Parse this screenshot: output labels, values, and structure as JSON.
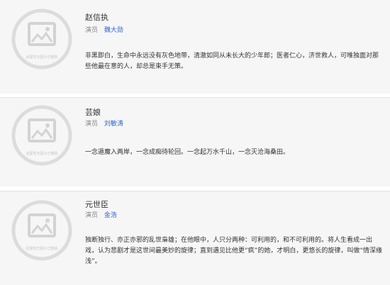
{
  "cast": [
    {
      "character": "赵信执",
      "role_label": "演员",
      "actor": "魏大勋",
      "description": "非黑即白，生命中永远没有灰色地带，清澈如同从未长大的少年郎；医者仁心，济世救人，可唯独面对那些他最在意的人，却总是束手无策。",
      "placeholder_caption": "此图暂无图片已删除"
    },
    {
      "character": "芸娘",
      "role_label": "演员",
      "actor": "刘敏涛",
      "description": "一念遁魔入两岸，一念成痴待轮回。一念起万水千山，一念灭沧海桑田。",
      "placeholder_caption": "此图暂无图片已删除"
    },
    {
      "character": "元世臣",
      "role_label": "演员",
      "actor": "金浩",
      "description": "独断独行、亦正亦邪的乱世枭雄；在他眼中，人只分两种：可利用的，和不可利用的。将人生看成一出戏，认为悲剧才是这世间最美妙的旋律；直到遇见比他更“疯”的她，才明白，更悠长的旋律，叫做“情深缘浅”。",
      "placeholder_caption": "此图暂无图片已删除"
    }
  ],
  "colors": {
    "card_background": "#f6f6f6",
    "link": "#3366cc",
    "muted_text": "#888888",
    "placeholder": "#d9d9d9"
  },
  "icons": {
    "placeholder": "image-placeholder-icon"
  }
}
